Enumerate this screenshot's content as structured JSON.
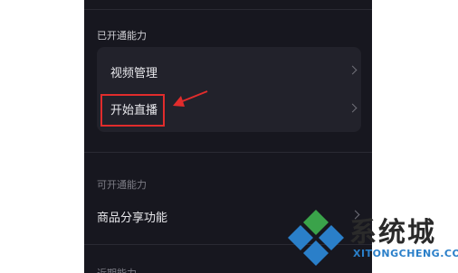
{
  "sections": {
    "enabled_title": "已开通能力",
    "available_title": "可开通能力",
    "bottom_title": "近期能力"
  },
  "enabled_items": [
    {
      "label": "视频管理"
    },
    {
      "label": "开始直播"
    }
  ],
  "available_items": [
    {
      "label": "商品分享功能"
    }
  ],
  "watermark": {
    "text": "系统城",
    "url": "XITONGCHENG.COM"
  },
  "colors": {
    "background": "#17171f",
    "card": "#22222b",
    "highlight": "#e12c2c",
    "watermark_blue": "#2a7fc9",
    "watermark_green": "#3aa34a"
  }
}
